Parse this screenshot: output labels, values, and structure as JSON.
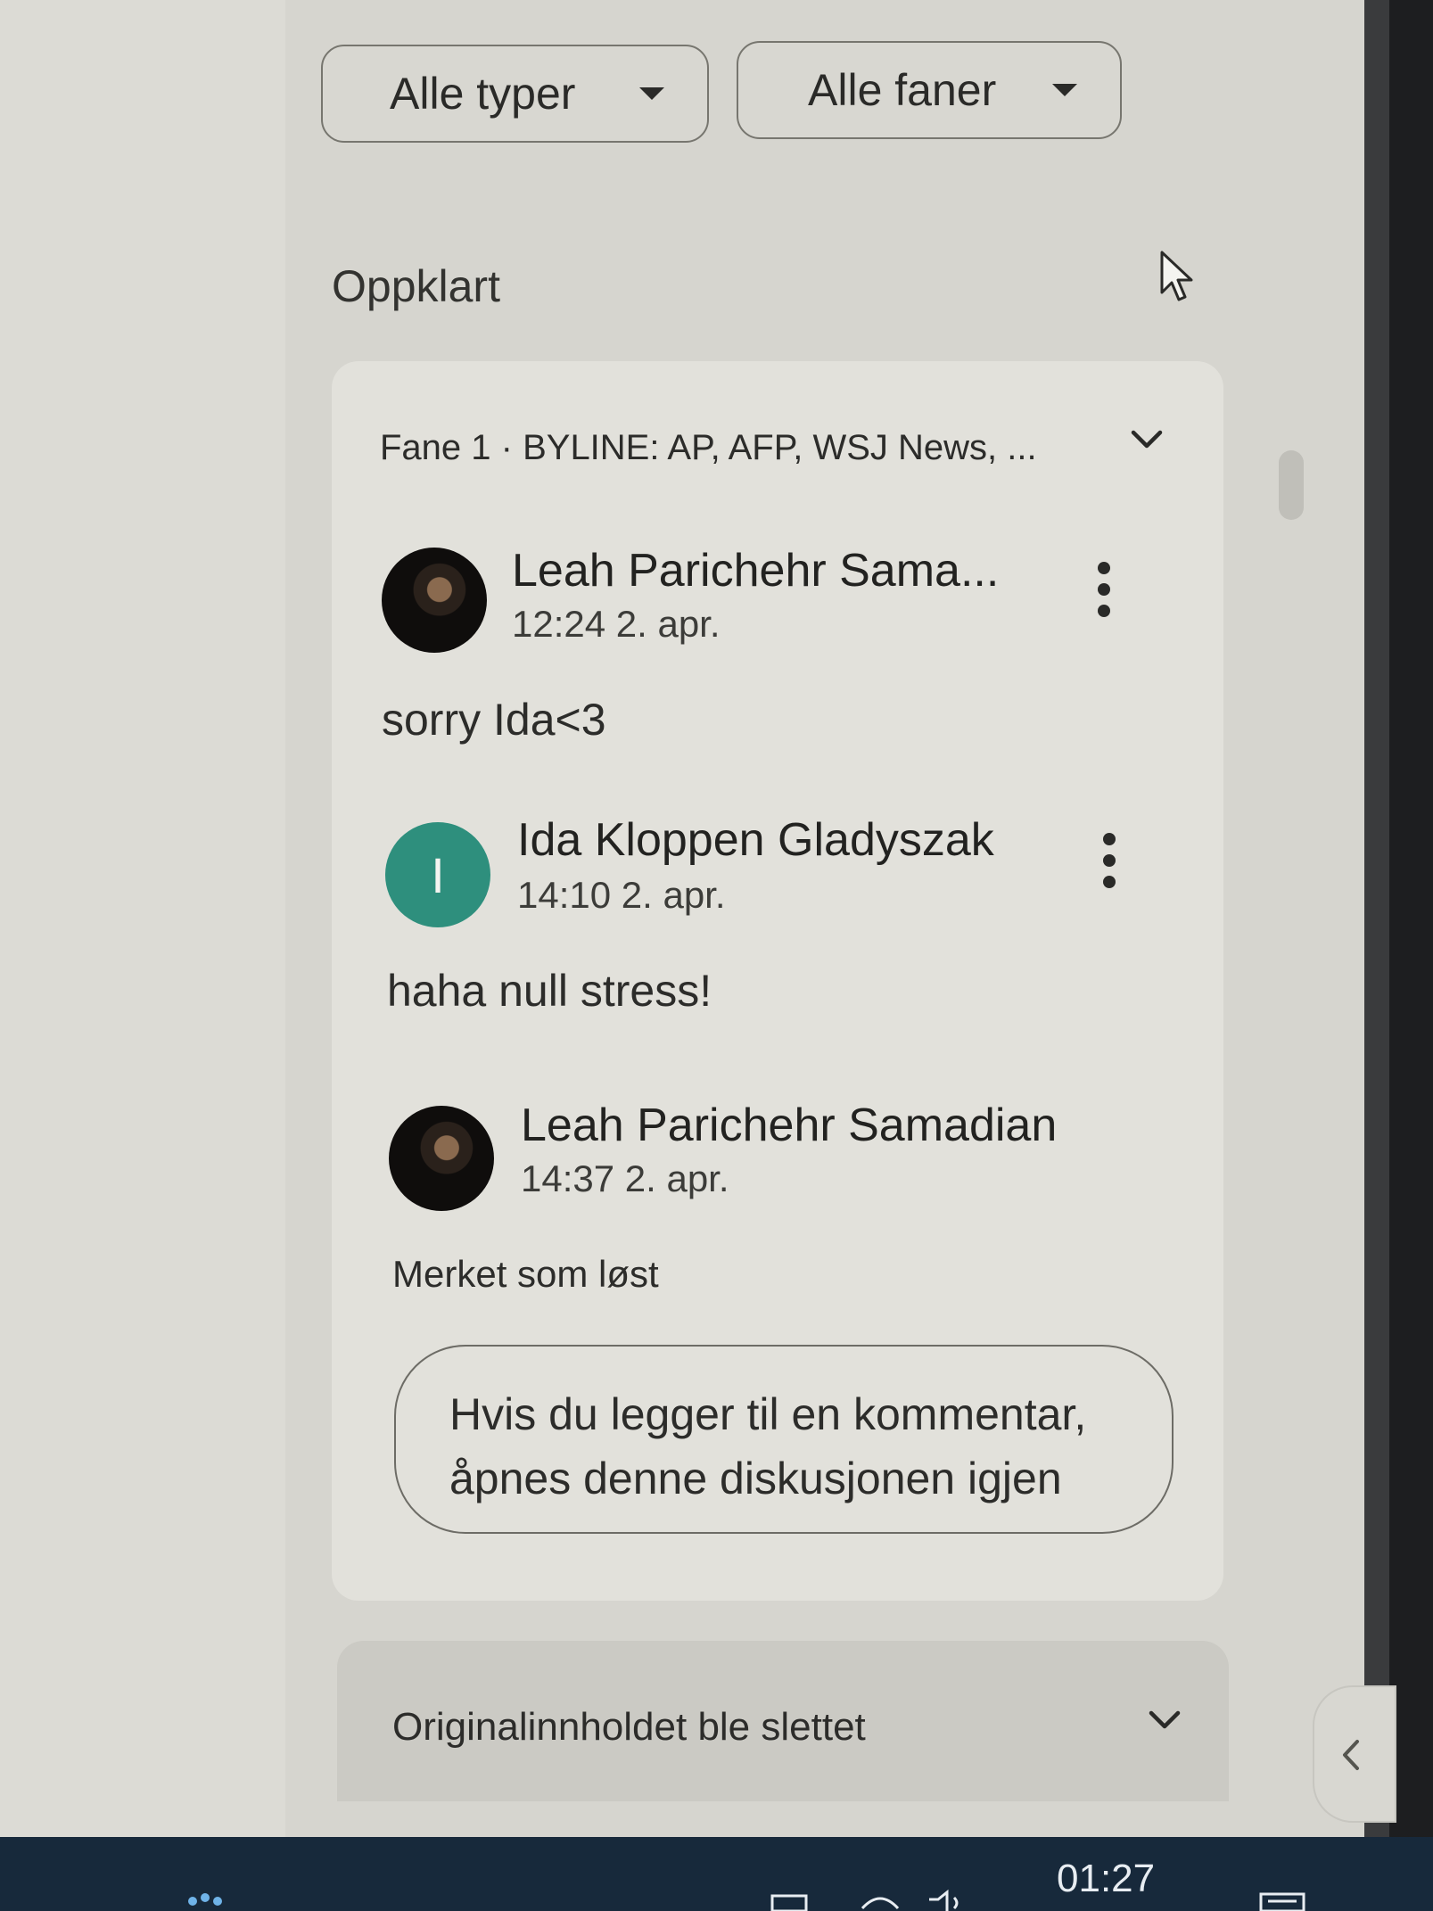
{
  "filters": {
    "types_label": "Alle typer",
    "tabs_label": "Alle faner"
  },
  "section_title": "Oppklart",
  "thread": {
    "header": "Fane 1 · BYLINE: AP, AFP, WSJ News, ...",
    "comments": [
      {
        "author": "Leah Parichehr Sama...",
        "time": "12:24 2. apr.",
        "text": "sorry Ida<3",
        "avatar": "photo"
      },
      {
        "author": "Ida Kloppen Gladyszak",
        "time": "14:10 2. apr.",
        "text": "haha null stress!",
        "avatar": "I"
      },
      {
        "author": "Leah Parichehr Samadian",
        "time": "14:37 2. apr.",
        "text": "Merket som løst",
        "avatar": "photo"
      }
    ],
    "reopen_hint_line1": "Hvis du legger til en kommentar,",
    "reopen_hint_line2": "åpnes denne diskusjonen igjen"
  },
  "thread2": {
    "title": "Originalinnholdet ble slettet"
  },
  "taskbar": {
    "clock": "01:27"
  },
  "colors": {
    "avatar_letter_bg": "#2e8f7d",
    "taskbar_bg": "#17293b"
  }
}
